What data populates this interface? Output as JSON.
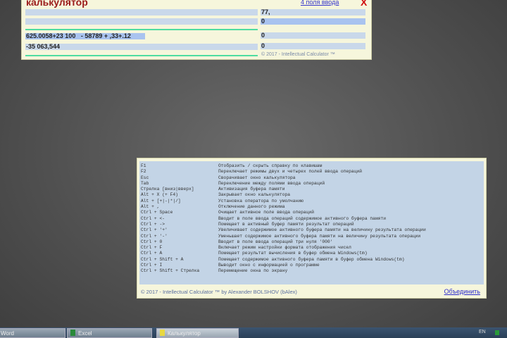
{
  "calculator": {
    "title": "калькулятор",
    "mode_link": "4 поля ввода",
    "close": "X",
    "fields": [
      {
        "expr": "",
        "result": "77,"
      },
      {
        "expr": "",
        "result": "0"
      },
      {
        "expr": "625.0058+23 100   - 58789 + ,33+.12",
        "result": "0"
      },
      {
        "expr": "-35 063,544",
        "result": "0"
      }
    ],
    "footer": "© 2017 - Intellectual Calculator ™"
  },
  "help": {
    "rows": [
      {
        "key": "F1",
        "desc": "Отобразить / скрыть справку по клавишам"
      },
      {
        "key": "F2",
        "desc": "Переключает режимы двух и четырех полей ввода операций"
      },
      {
        "key": "Esc",
        "desc": "Сворачивает окно калькулятора"
      },
      {
        "key": "Tab",
        "desc": "Переключение между полями ввода операций"
      },
      {
        "key": "Стрелка [вниз|вверх]",
        "desc": "Активизация буфера памяти"
      },
      {
        "key": "Alt + X (+ F4)",
        "desc": "Закрывает окно калькулятора"
      },
      {
        "key": "Alt + [+|-|*|/]",
        "desc": "Установка оператора по умолчанию"
      },
      {
        "key": "Alt + ,",
        "desc": "Отключение данного режима"
      },
      {
        "key": "Ctrl + Space",
        "desc": "Очищает активное поле ввода операций"
      },
      {
        "key": "Ctrl + <-",
        "desc": "Вводит в поле ввода операций содержимое активного буфера памяти"
      },
      {
        "key": "Ctrl + ->",
        "desc": "Помещает в активный буфер памяти результат операций"
      },
      {
        "key": "Ctrl + '+'",
        "desc": "Увеличивает содержимое активного буфера памяти на величину результата операции"
      },
      {
        "key": "Ctrl + '-'",
        "desc": "Уменьшает содержимое активного буфера памяти на величину результата операции"
      },
      {
        "key": "Ctrl + 0",
        "desc": "Вводит в поле ввода операций три нуля '000'"
      },
      {
        "key": "Ctrl + F",
        "desc": "Включает режим настройки формата отображения чисел"
      },
      {
        "key": "Ctrl + A",
        "desc": "Помещает результат вычисления в буфер обмена Windows(tm)"
      },
      {
        "key": "Ctrl + Shift + A",
        "desc": "Помещает содержимое активного буфера памяти в буфер обмена Windows(tm)"
      },
      {
        "key": "Ctrl + I",
        "desc": "Выводит окно с информацией о программе"
      },
      {
        "key": "Ctrl + Shift + Стрелка",
        "desc": "Перемещение окна по экрану"
      }
    ],
    "footer": "© 2017 - Intellectual Calculator ™ by Alexander BOLSHOV (bAlex)",
    "unite_link": "Объединить"
  },
  "taskbar": {
    "items": [
      {
        "label": "Word"
      },
      {
        "label": "Excel"
      },
      {
        "label": "Калькулятор"
      }
    ],
    "lang": "EN"
  }
}
